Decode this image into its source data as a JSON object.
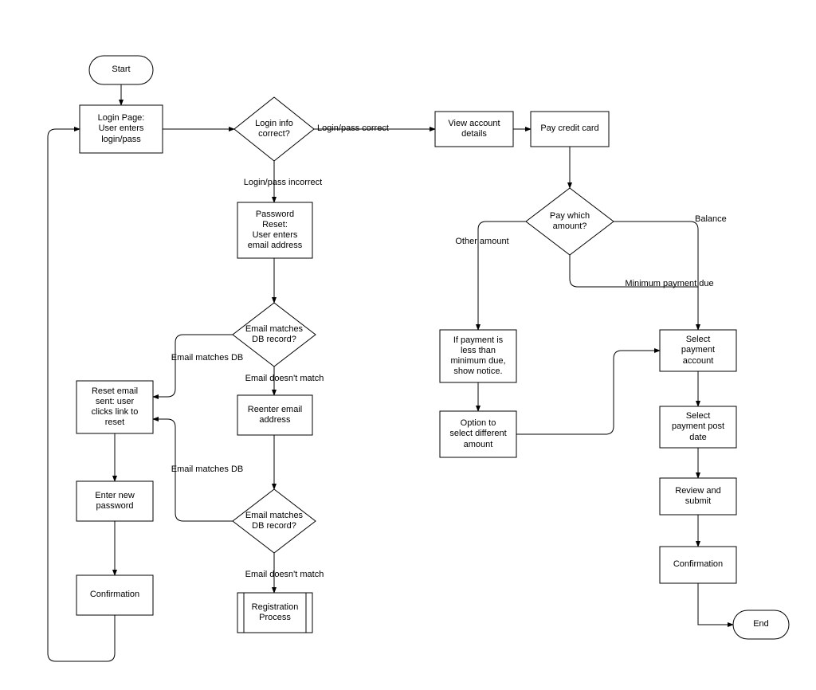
{
  "nodes": {
    "start": "Start",
    "login": "Login Page:\nUser enters\nlogin/pass",
    "loginCorrect": "Login info\ncorrect?",
    "loginPassCorrect": "Login/pass correct",
    "loginPassIncorrect": "Login/pass incorrect",
    "passwordReset": "Password\nReset:\nUser enters\nemail address",
    "emailMatch1": "Email matches\nDB record?",
    "emailMatchesDB": "Email matches DB",
    "emailDoesntMatch": "Email doesn't match",
    "reenterEmail": "Reenter email\naddress",
    "emailMatch2": "Email matches\nDB record?",
    "emailMatchesDB2": "Email matches DB",
    "emailDoesntMatch2": "Email doesn't match",
    "registration": "Registration\nProcess",
    "resetEmailSent": "Reset email\nsent: user\nclicks link to\nreset",
    "enterNewPass": "Enter new\npassword",
    "confirmation1": "Confirmation",
    "viewAccount": "View account\ndetails",
    "payCC": "Pay credit card",
    "payWhich": "Pay which\namount?",
    "otherAmount": "Other amount",
    "balance": "Balance",
    "minPayment": "Minimum payment due",
    "paymentNotice": "If payment is\nless than\nminimum due,\nshow notice.",
    "selectDifferent": "Option to\nselect different\namount",
    "selectPayAccount": "Select\npayment\naccount",
    "selectPostDate": "Select\npayment post\ndate",
    "reviewSubmit": "Review and\nsubmit",
    "confirmation2": "Confirmation",
    "end": "End"
  }
}
